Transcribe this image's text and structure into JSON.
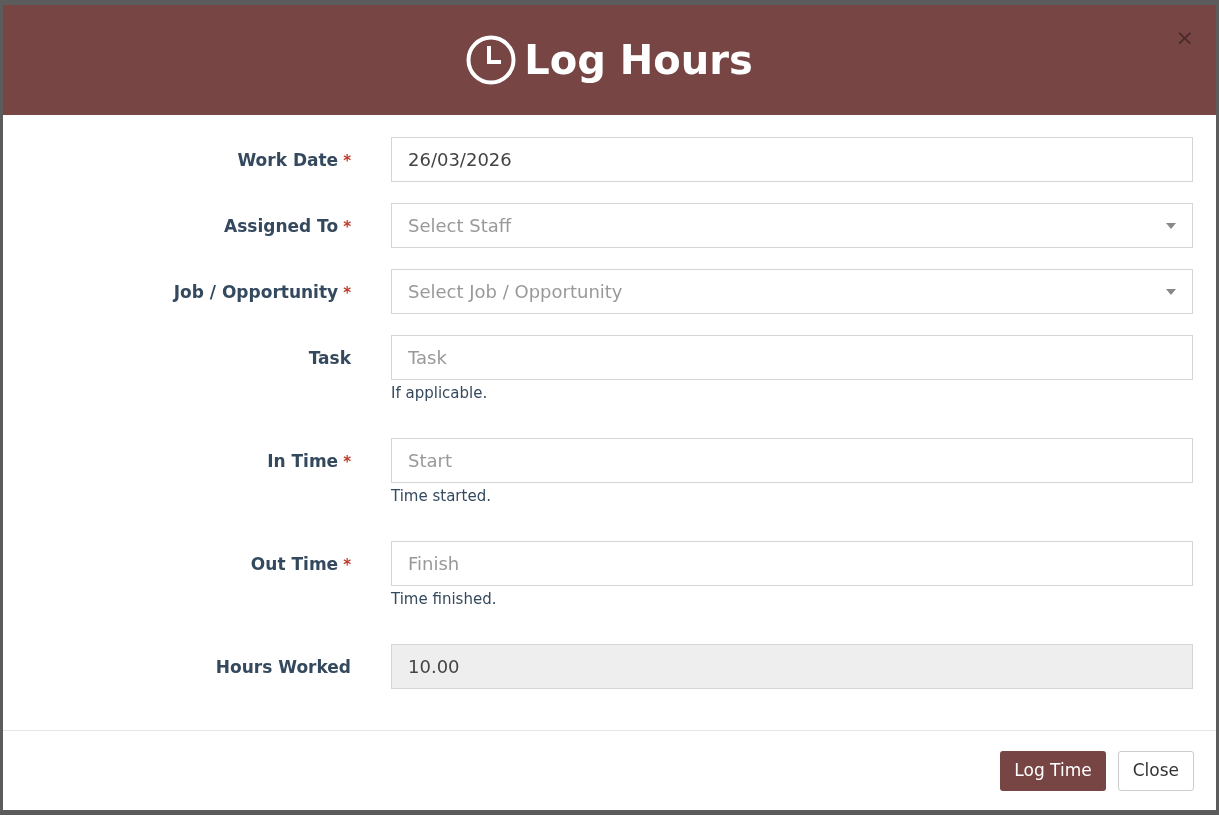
{
  "modal": {
    "title": "Log Hours",
    "close": "×"
  },
  "fields": [
    {
      "kind": "text",
      "label": "Work Date",
      "required": true,
      "value": "26/03/2026"
    },
    {
      "kind": "select",
      "label": "Assigned To",
      "required": true,
      "placeholder": "Select Staff"
    },
    {
      "kind": "select",
      "label": "Job / Opportunity",
      "required": true,
      "placeholder": "Select Job / Opportunity"
    },
    {
      "kind": "text",
      "label": "Task",
      "required": false,
      "placeholder": "Task",
      "help": "If applicable."
    },
    {
      "kind": "text",
      "label": "In Time",
      "required": true,
      "placeholder": "Start",
      "help": "Time started."
    },
    {
      "kind": "text",
      "label": "Out Time",
      "required": true,
      "placeholder": "Finish",
      "help": "Time finished."
    },
    {
      "kind": "readonly",
      "label": "Hours Worked",
      "required": false,
      "value": "10.00"
    }
  ],
  "required_mark": "*",
  "buttons": [
    {
      "label": "Log Time",
      "kind": "primary"
    },
    {
      "label": "Close",
      "kind": "secondary"
    }
  ]
}
